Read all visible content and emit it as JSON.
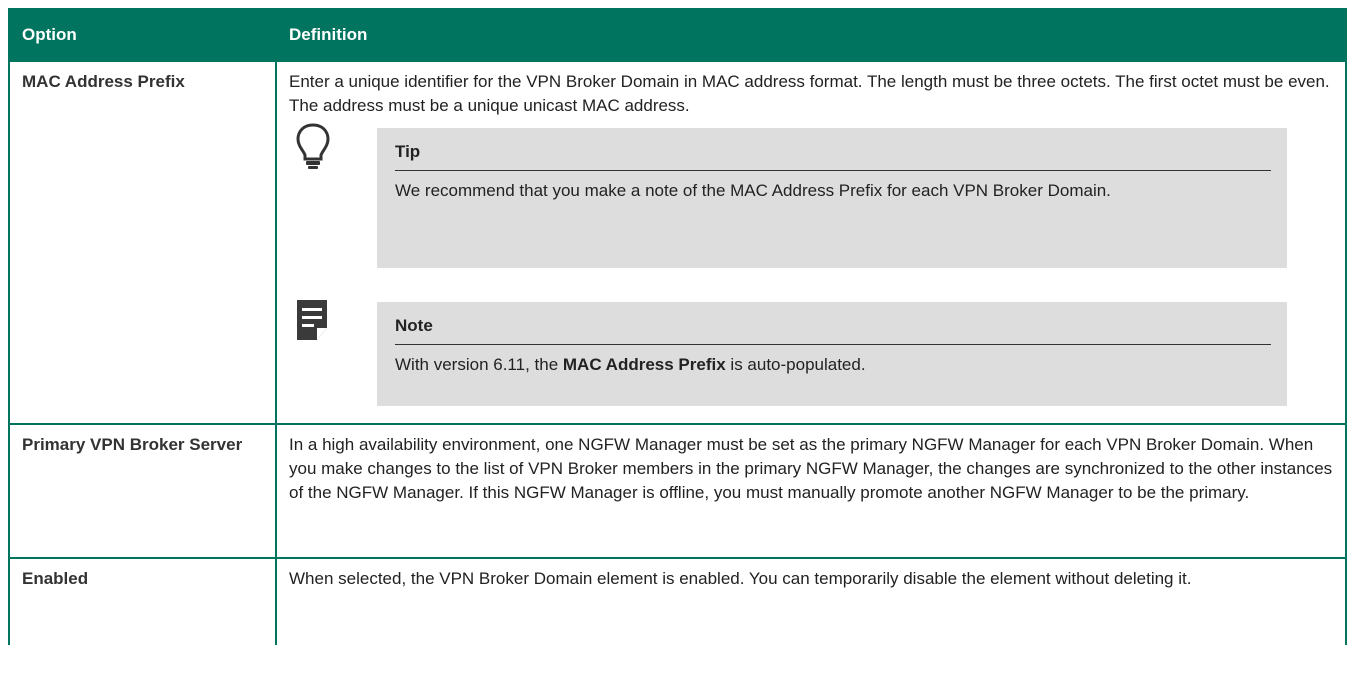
{
  "table": {
    "headers": {
      "option": "Option",
      "definition": "Definition"
    },
    "rows": [
      {
        "option": "MAC Address Prefix",
        "definition": "Enter a unique identifier for the VPN Broker Domain in MAC address format. The length must be three octets. The first octet must be even. The address must be a unique unicast MAC address.",
        "tip": {
          "title": "Tip",
          "text": "We recommend that you make a note of the MAC Address Prefix for each VPN Broker Domain."
        },
        "note": {
          "title": "Note",
          "text_before": "With version 6.11, the ",
          "text_bold": "MAC Address Prefix",
          "text_after": " is auto-populated."
        }
      },
      {
        "option": "Primary VPN Broker Server",
        "definition": "In a high availability environment, one NGFW Manager must be set as the primary NGFW Manager for each VPN Broker Domain. When you make changes to the list of VPN Broker members in the primary NGFW Manager, the changes are synchronized to the other instances of the NGFW Manager. If this NGFW Manager is offline, you must manually promote another NGFW Manager to be the primary."
      },
      {
        "option": "Enabled",
        "definition": "When selected, the VPN Broker Domain element is enabled. You can temporarily disable the element without deleting it."
      }
    ]
  },
  "icons": {
    "tip": "lightbulb-icon",
    "note": "note-icon"
  },
  "colors": {
    "header_bg": "#00745f",
    "callout_bg": "#dddddd"
  }
}
